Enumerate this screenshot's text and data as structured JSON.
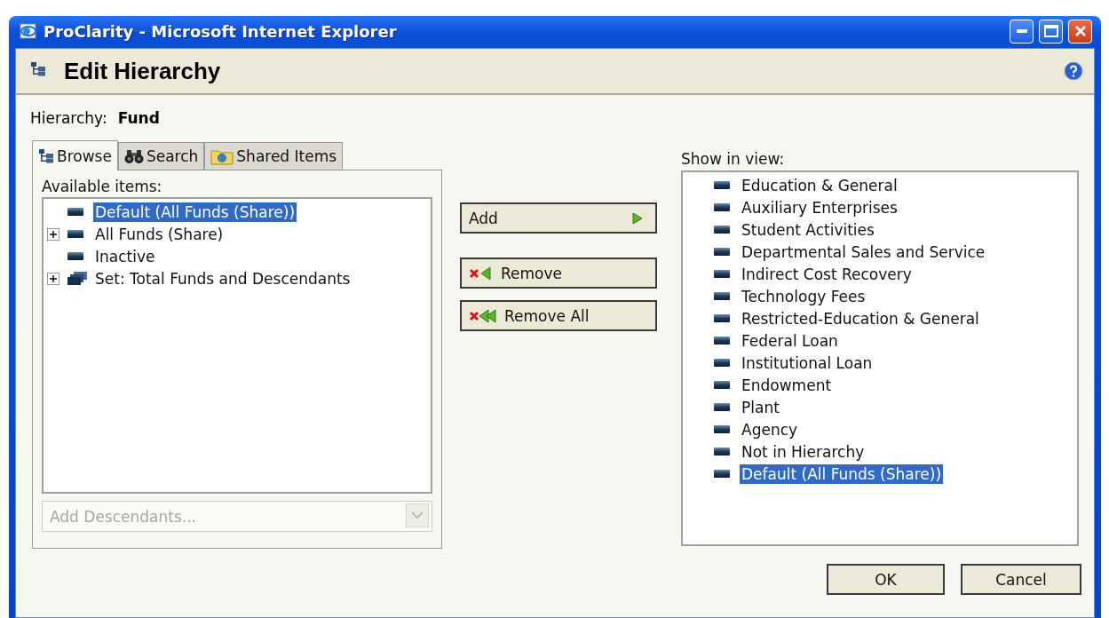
{
  "window": {
    "title": "ProClarity - Microsoft Internet Explorer"
  },
  "dialog": {
    "title": "Edit Hierarchy"
  },
  "hierarchy": {
    "label": "Hierarchy:",
    "value": "Fund"
  },
  "tabs": [
    {
      "label": "Browse",
      "kind": "browse",
      "selected": true
    },
    {
      "label": "Search",
      "kind": "search",
      "selected": false
    },
    {
      "label": "Shared Items",
      "kind": "shared",
      "selected": false
    }
  ],
  "available": {
    "label": "Available items:",
    "items": [
      {
        "label": "Default (All Funds (Share))",
        "kind": "member",
        "expandable": false,
        "selected": true
      },
      {
        "label": "All Funds (Share)",
        "kind": "member",
        "expandable": true,
        "selected": false
      },
      {
        "label": "Inactive",
        "kind": "member",
        "expandable": false,
        "selected": false
      },
      {
        "label": "Set: Total Funds and Descendants",
        "kind": "set",
        "expandable": true,
        "selected": false
      }
    ],
    "dropdown": {
      "placeholder": "Add Descendants...",
      "disabled": true
    }
  },
  "actions": [
    {
      "label": "Add",
      "kind": "add"
    },
    {
      "label": "Remove",
      "kind": "remove"
    },
    {
      "label": "Remove All",
      "kind": "remove-all"
    }
  ],
  "show_in_view": {
    "label": "Show in view:",
    "items": [
      {
        "label": "Education & General",
        "selected": false
      },
      {
        "label": "Auxiliary Enterprises",
        "selected": false
      },
      {
        "label": "Student Activities",
        "selected": false
      },
      {
        "label": "Departmental Sales and Service",
        "selected": false
      },
      {
        "label": "Indirect Cost Recovery",
        "selected": false
      },
      {
        "label": "Technology Fees",
        "selected": false
      },
      {
        "label": "Restricted-Education & General",
        "selected": false
      },
      {
        "label": "Federal Loan",
        "selected": false
      },
      {
        "label": "Institutional Loan",
        "selected": false
      },
      {
        "label": "Endowment",
        "selected": false
      },
      {
        "label": "Plant",
        "selected": false
      },
      {
        "label": "Agency",
        "selected": false
      },
      {
        "label": "Not in Hierarchy",
        "selected": false
      },
      {
        "label": "Default (All Funds (Share))",
        "selected": true
      }
    ]
  },
  "buttons": [
    {
      "label": "OK"
    },
    {
      "label": "Cancel"
    }
  ]
}
